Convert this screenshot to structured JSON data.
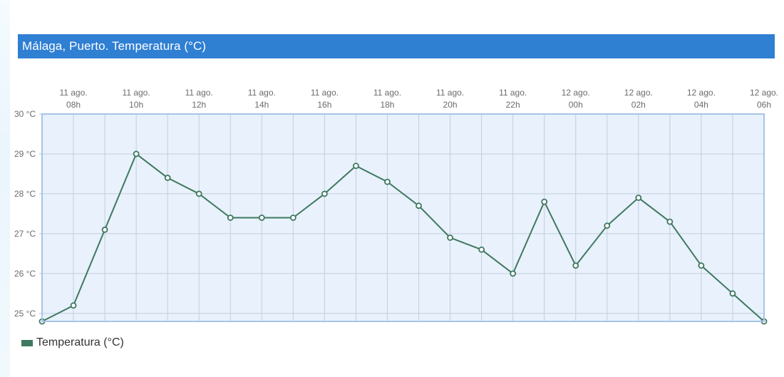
{
  "header": {
    "title": "Málaga, Puerto. Temperatura (°C)"
  },
  "colors": {
    "title_bar": "#2f7fd3",
    "plot_background": "#e8f1fc",
    "plot_border": "#a7c4e6",
    "grid": "#c3cfdb",
    "series": "#3f7860"
  },
  "legend": {
    "placement": "bottom-left",
    "items": [
      {
        "label": "Temperatura (°C)",
        "color": "#3f7860"
      }
    ]
  },
  "chart_data": {
    "type": "line",
    "title": "Málaga, Puerto. Temperatura (°C)",
    "xlabel": "",
    "ylabel": "",
    "x_axis_position": "top",
    "grid": true,
    "markers": "hollow-circle",
    "x": [
      "11 ago. 07h",
      "11 ago. 08h",
      "11 ago. 09h",
      "11 ago. 10h",
      "11 ago. 11h",
      "11 ago. 12h",
      "11 ago. 13h",
      "11 ago. 14h",
      "11 ago. 15h",
      "11 ago. 16h",
      "11 ago. 17h",
      "11 ago. 18h",
      "11 ago. 19h",
      "11 ago. 20h",
      "11 ago. 21h",
      "11 ago. 22h",
      "11 ago. 23h",
      "12 ago. 00h",
      "12 ago. 01h",
      "12 ago. 02h",
      "12 ago. 03h",
      "12 ago. 04h",
      "12 ago. 05h",
      "12 ago. 06h"
    ],
    "x_tick_labels": [
      {
        "date": "11 ago.",
        "hour": "08h",
        "index": 1
      },
      {
        "date": "11 ago.",
        "hour": "10h",
        "index": 3
      },
      {
        "date": "11 ago.",
        "hour": "12h",
        "index": 5
      },
      {
        "date": "11 ago.",
        "hour": "14h",
        "index": 7
      },
      {
        "date": "11 ago.",
        "hour": "16h",
        "index": 9
      },
      {
        "date": "11 ago.",
        "hour": "18h",
        "index": 11
      },
      {
        "date": "11 ago.",
        "hour": "20h",
        "index": 13
      },
      {
        "date": "11 ago.",
        "hour": "22h",
        "index": 15
      },
      {
        "date": "12 ago.",
        "hour": "00h",
        "index": 17
      },
      {
        "date": "12 ago.",
        "hour": "02h",
        "index": 19
      },
      {
        "date": "12 ago.",
        "hour": "04h",
        "index": 21
      },
      {
        "date": "12 ago.",
        "hour": "06h",
        "index": 23
      }
    ],
    "ylim": [
      24.8,
      30
    ],
    "y_ticks": [
      {
        "value": 25,
        "label": "25 °C"
      },
      {
        "value": 26,
        "label": "26 °C"
      },
      {
        "value": 27,
        "label": "27 °C"
      },
      {
        "value": 28,
        "label": "28 °C"
      },
      {
        "value": 29,
        "label": "29 °C"
      },
      {
        "value": 30,
        "label": "30 °C"
      }
    ],
    "series": [
      {
        "name": "Temperatura (°C)",
        "values": [
          24.8,
          25.2,
          27.1,
          29.0,
          28.4,
          28.0,
          27.4,
          27.4,
          27.4,
          28.0,
          28.7,
          28.3,
          27.7,
          26.9,
          26.6,
          26.0,
          27.8,
          26.2,
          27.2,
          27.9,
          27.3,
          26.2,
          25.5,
          24.8
        ]
      }
    ]
  }
}
